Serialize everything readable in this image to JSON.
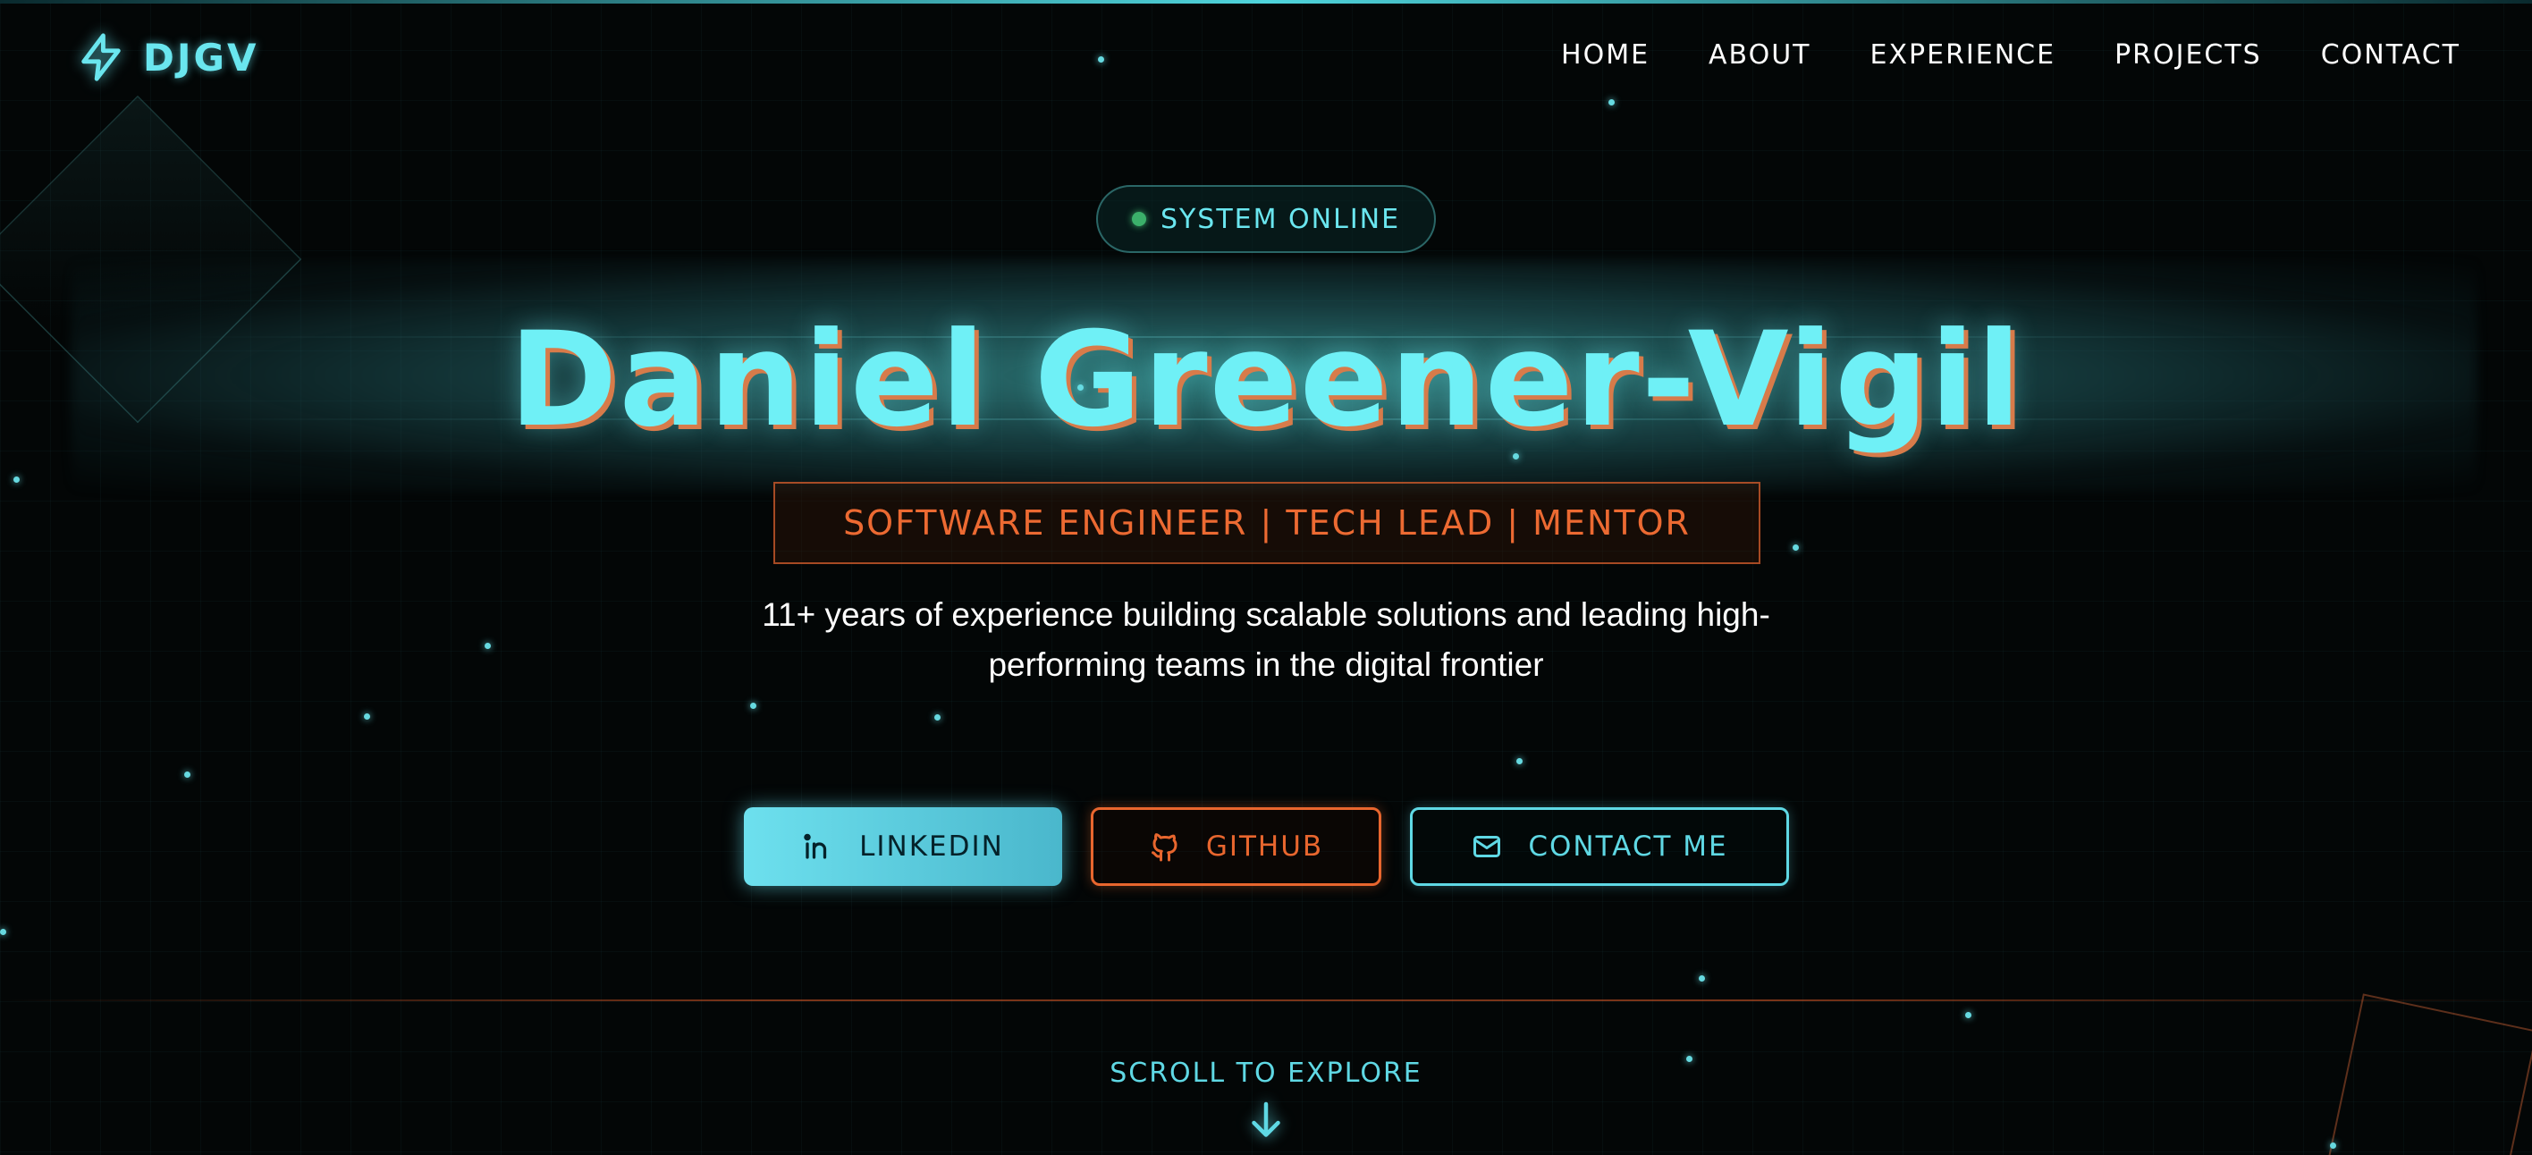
{
  "brand": {
    "logo_text": "DJGV",
    "icon": "lightning-bolt-icon"
  },
  "nav": {
    "items": [
      {
        "label": "HOME"
      },
      {
        "label": "ABOUT"
      },
      {
        "label": "EXPERIENCE"
      },
      {
        "label": "PROJECTS"
      },
      {
        "label": "CONTACT"
      }
    ]
  },
  "hero": {
    "status": "SYSTEM ONLINE",
    "name": "Daniel Greener-Vigil",
    "roles": "SOFTWARE ENGINEER | TECH LEAD | MENTOR",
    "tagline": "11+ years of experience building scalable solutions and leading high-performing teams in the digital frontier"
  },
  "buttons": {
    "linkedin": {
      "label": "LINKEDIN",
      "icon": "linkedin-icon"
    },
    "github": {
      "label": "GITHUB",
      "icon": "github-icon"
    },
    "contact": {
      "label": "CONTACT ME",
      "icon": "mail-icon"
    }
  },
  "scroll_hint": {
    "label": "SCROLL TO EXPLORE",
    "icon": "arrow-down-icon"
  },
  "colors": {
    "background": "#030606",
    "accent_cyan": "#6ae6ef",
    "accent_orange": "#e8662e",
    "status_green": "#3bb06a"
  }
}
